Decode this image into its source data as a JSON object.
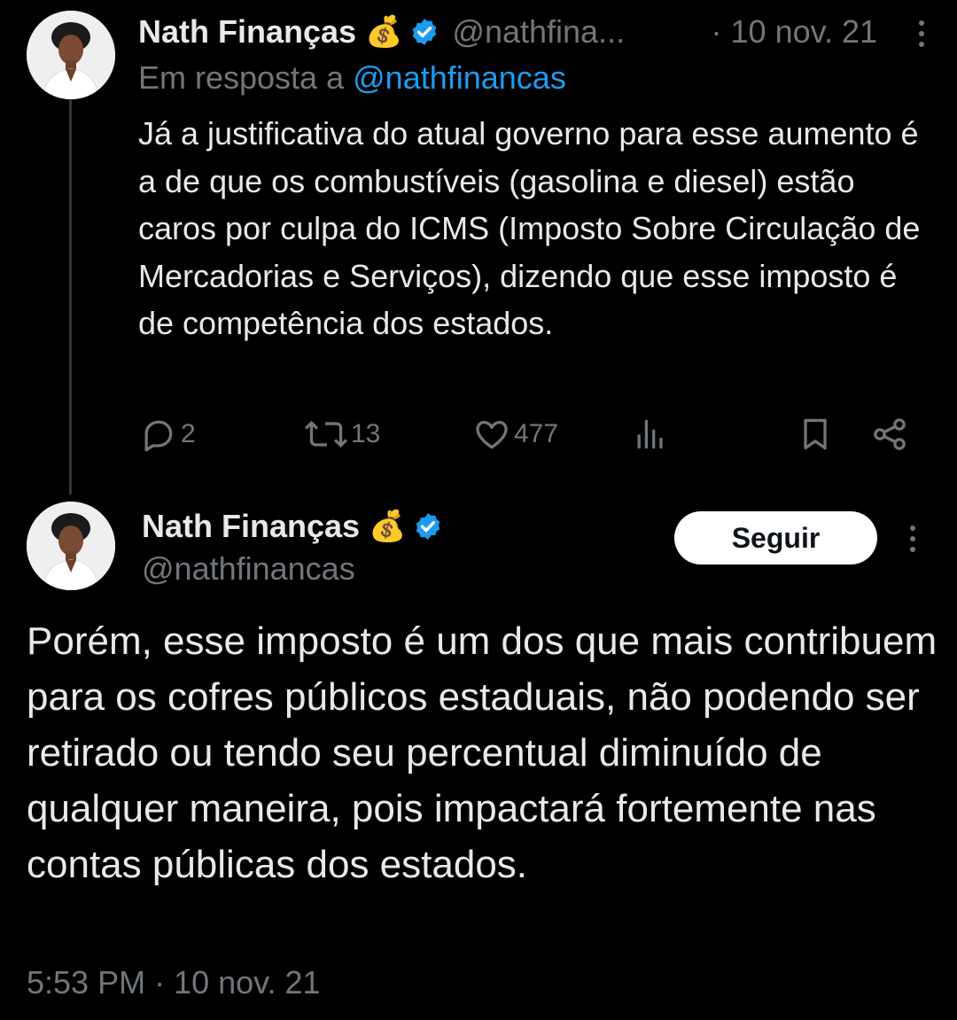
{
  "reply_tweet": {
    "display_name": "Nath Finanças",
    "emoji": "💰",
    "handle": "@nathfina...",
    "date": "· 10 nov. 21",
    "reply_prefix": "Em resposta a",
    "reply_mention": "@nathfinancas",
    "text": "Já a justificativa do atual governo para esse aumento é a de que os combustíveis (gasolina e diesel) estão caros por culpa do ICMS (Imposto Sobre Circulação de Mercadorias e Serviços), dizendo que esse imposto é de competência dos estados.",
    "actions": {
      "replies": "2",
      "retweets": "13",
      "likes": "477"
    }
  },
  "main_tweet": {
    "display_name": "Nath Finanças",
    "emoji": "💰",
    "handle": "@nathfinancas",
    "follow_label": "Seguir",
    "text": "Porém, esse imposto é um dos que mais contribuem para os cofres públicos estaduais, não podendo ser retirado ou tendo seu percentual diminuído de qualquer maneira, pois impactará fortemente nas contas públicas dos estados.",
    "timestamp": "5:53 PM · 10 nov. 21"
  },
  "icons": [
    "verified-badge-icon",
    "more-icon",
    "reply-icon",
    "retweet-icon",
    "like-icon",
    "views-icon",
    "bookmark-icon",
    "share-icon"
  ],
  "colors": {
    "background": "#000000",
    "text": "#e7e9ea",
    "muted": "#71767b",
    "accent": "#1d9bf0",
    "thread_line": "#333639"
  }
}
